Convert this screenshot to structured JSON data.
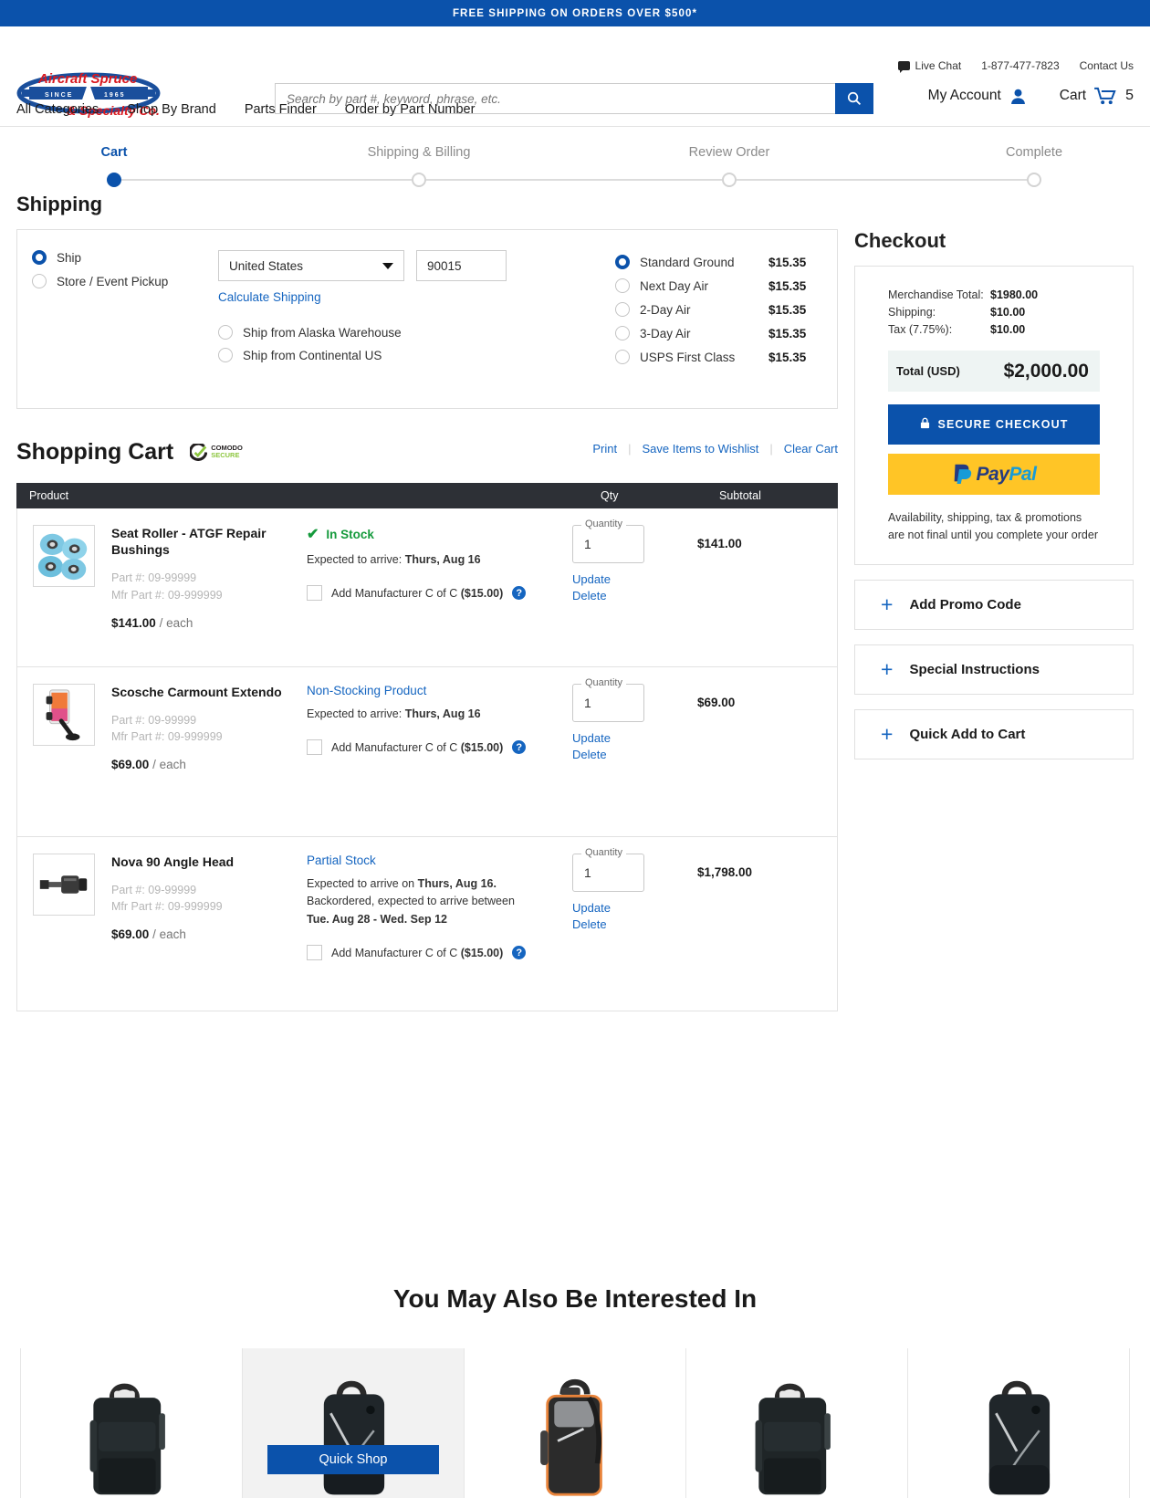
{
  "promo_banner": "FREE SHIPPING ON ORDERS OVER $500*",
  "header": {
    "logo_line1": "Aircraft Spruce",
    "logo_since": "SINCE",
    "logo_year": "1965",
    "logo_line2": "& Specialty Co.",
    "live_chat": "Live Chat",
    "phone": "1-877-477-7823",
    "contact_us": "Contact Us",
    "my_account": "My Account",
    "cart": "Cart",
    "cart_count": "5",
    "search_placeholder": "Search by part #, keyword, phrase, etc.",
    "search_value": "",
    "nav": [
      {
        "label": "All Categories"
      },
      {
        "label": "Shop By Brand"
      },
      {
        "label": "Parts Finder"
      },
      {
        "label": "Order by Part Number"
      }
    ]
  },
  "stepper": {
    "steps": [
      {
        "label": "Cart",
        "active": true
      },
      {
        "label": "Shipping & Billing",
        "active": false
      },
      {
        "label": "Review Order",
        "active": false
      },
      {
        "label": "Complete",
        "active": false
      }
    ]
  },
  "shipping": {
    "title": "Shipping",
    "delivery_options": [
      {
        "label": "Ship",
        "selected": true
      },
      {
        "label": "Store / Event Pickup",
        "selected": false
      }
    ],
    "country": "United States",
    "zip": "90015",
    "calculate_link": "Calculate Shipping",
    "warehouse_options": [
      {
        "label": "Ship from Alaska Warehouse",
        "selected": false
      },
      {
        "label": "Ship from Continental US",
        "selected": false
      }
    ],
    "methods": [
      {
        "name": "Standard Ground",
        "price": "$15.35",
        "selected": true
      },
      {
        "name": "Next Day Air",
        "price": "$15.35",
        "selected": false
      },
      {
        "name": "2-Day Air",
        "price": "$15.35",
        "selected": false
      },
      {
        "name": "3-Day Air",
        "price": "$15.35",
        "selected": false
      },
      {
        "name": "USPS First Class",
        "price": "$15.35",
        "selected": false
      }
    ]
  },
  "cart": {
    "title": "Shopping Cart",
    "badge_line1": "COMODO",
    "badge_line2": "SECURE",
    "actions": {
      "print": "Print",
      "wishlist": "Save Items to Wishlist",
      "clear": "Clear Cart"
    },
    "columns": {
      "product": "Product",
      "qty": "Qty",
      "subtotal": "Subtotal"
    },
    "items": [
      {
        "name": "Seat Roller - ATGF Repair Bushings",
        "part": "Part #: 09-99999",
        "mfr_part": "Mfr Part #: 09-999999",
        "unit_price": "$141.00",
        "unit_suffix": "/ each",
        "stock_status": "In Stock",
        "stock_type": "in-stock",
        "arrive_prefix": "Expected to arrive: ",
        "arrive_date": "Thurs, Aug 16",
        "arrive_extra": "",
        "arrive_extra_bold": "",
        "coc_label": "Add Manufacturer C of C ",
        "coc_price": "($15.00)",
        "coc_checked": false,
        "qty_legend": "Quantity",
        "qty_value": "1",
        "update": "Update",
        "delete": "Delete",
        "subtotal": "$141.00"
      },
      {
        "name": "Scosche Carmount Extendo",
        "part": "Part #: 09-99999",
        "mfr_part": "Mfr Part #: 09-999999",
        "unit_price": "$69.00",
        "unit_suffix": "/ each",
        "stock_status": "Non-Stocking Product",
        "stock_type": "link",
        "arrive_prefix": "Expected to arrive: ",
        "arrive_date": "Thurs, Aug 16",
        "arrive_extra": "",
        "arrive_extra_bold": "",
        "coc_label": "Add Manufacturer C of C ",
        "coc_price": "($15.00)",
        "coc_checked": false,
        "qty_legend": "Quantity",
        "qty_value": "1",
        "update": "Update",
        "delete": "Delete",
        "subtotal": "$69.00"
      },
      {
        "name": "Nova 90 Angle Head",
        "part": "Part #: 09-99999",
        "mfr_part": "Mfr Part #: 09-999999",
        "unit_price": "$69.00",
        "unit_suffix": "/ each",
        "stock_status": "Partial Stock",
        "stock_type": "link",
        "arrive_prefix": "Expected to arrive on ",
        "arrive_date": "Thurs, Aug 16.",
        "arrive_extra": "Backordered, expected to arrive between",
        "arrive_extra_bold": "Tue. Aug 28 - Wed. Sep 12",
        "coc_label": "Add Manufacturer C of C ",
        "coc_price": "($15.00)",
        "coc_checked": false,
        "qty_legend": "Quantity",
        "qty_value": "1",
        "update": "Update",
        "delete": "Delete",
        "subtotal": "$1,798.00"
      }
    ]
  },
  "checkout": {
    "title": "Checkout",
    "lines": [
      {
        "label": "Merchandise Total:",
        "value": "$1980.00"
      },
      {
        "label": "Shipping:",
        "value": "$10.00"
      },
      {
        "label": "Tax (7.75%):",
        "value": "$10.00"
      }
    ],
    "total_label": "Total (USD)",
    "total_value": "$2,000.00",
    "secure_button": "SECURE CHECKOUT",
    "paypal_pay": "Pay",
    "paypal_pal": "Pal",
    "disclaimer": "Availability, shipping, tax & promotions are not final until you complete your order",
    "accordions": [
      {
        "label": "Add Promo Code"
      },
      {
        "label": "Special Instructions"
      },
      {
        "label": "Quick Add to Cart"
      }
    ]
  },
  "recommendations": {
    "title": "You May Also Be Interested In",
    "quick_shop": "Quick Shop",
    "cards": [
      {
        "hovered": false
      },
      {
        "hovered": true
      },
      {
        "hovered": false
      },
      {
        "hovered": false
      },
      {
        "hovered": false
      }
    ]
  },
  "colors": {
    "brand_blue": "#0b52ab",
    "link_blue": "#1565c0",
    "in_stock_green": "#159a3c",
    "paypal_yellow": "#ffc526",
    "table_header_dark": "#2d3036"
  }
}
